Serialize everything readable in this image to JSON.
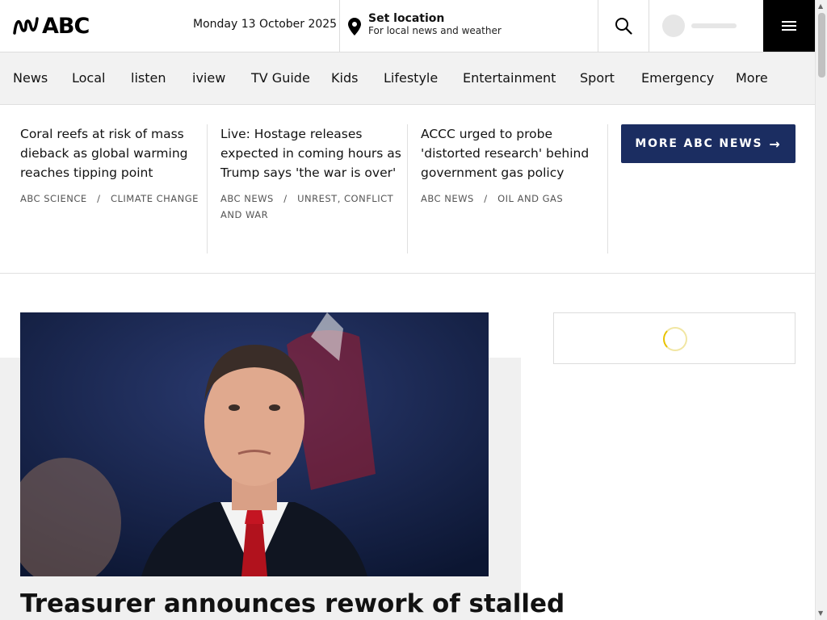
{
  "header": {
    "logo_text": "ABC",
    "date": "Monday 13 October 2025",
    "location_title": "Set location",
    "location_subtitle": "For local news and weather"
  },
  "nav": {
    "items": [
      "News",
      "Local",
      "listen",
      "iview",
      "TV Guide",
      "Kids",
      "Lifestyle",
      "Entertainment",
      "Sport",
      "Emergency",
      "More"
    ]
  },
  "top_stories": [
    {
      "title": "Coral reefs at risk of mass dieback as global warming reaches tipping point",
      "source": "ABC SCIENCE",
      "topic": "CLIMATE CHANGE"
    },
    {
      "title": "Live: Hostage releases expected in coming hours as Trump says 'the war is over'",
      "source": "ABC NEWS",
      "topic": "UNREST, CONFLICT AND WAR"
    },
    {
      "title": "ACCC urged to probe 'distorted research' behind government gas policy",
      "source": "ABC NEWS",
      "topic": "OIL AND GAS"
    }
  ],
  "more_button": "MORE ABC NEWS",
  "main_story": {
    "headline": "Treasurer announces rework of stalled"
  },
  "colors": {
    "button_bg": "#1b2d61",
    "nav_bg": "#f2f2f2",
    "spinner_accent": "#e8c200"
  }
}
